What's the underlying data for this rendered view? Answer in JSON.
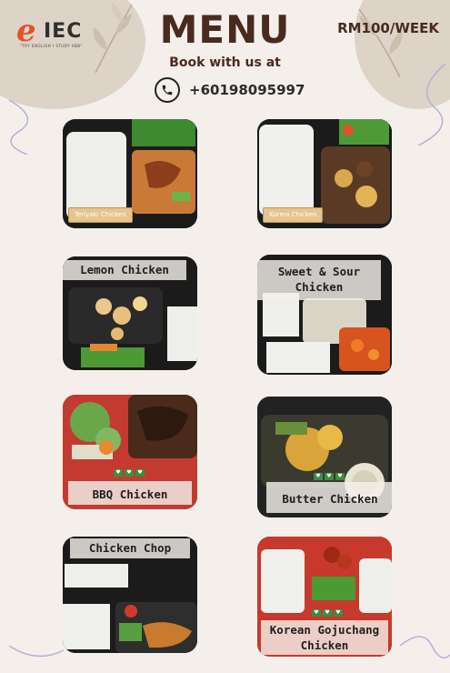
{
  "header": {
    "logo_letter": "e",
    "logo_text": "IEC",
    "logo_tagline": "\"TRY ENGLISH I STUDY ABB\"",
    "title": "MENU",
    "price": "RM100/WEEK",
    "book_text": "Book with us at",
    "phone": "+60198095997",
    "phone_icon": "phone-icon"
  },
  "colors": {
    "accent": "#4a2a1f",
    "background": "#f4efea",
    "logo_orange": "#e0542b",
    "label_gold": "#e6c48c",
    "heart_green": "#3e8d3e"
  },
  "menu": [
    {
      "name": "Teriyaki Chicken"
    },
    {
      "name": "Kurma Chicken"
    },
    {
      "name": "Lemon Chicken"
    },
    {
      "name": "Sweet & Sour Chicken",
      "line1": "Sweet & Sour",
      "line2": "Chicken"
    },
    {
      "name": "BBQ Chicken"
    },
    {
      "name": "Butter Chicken"
    },
    {
      "name": "Chicken Chop"
    },
    {
      "name": "Korean Gojuchang Chicken",
      "line1": "Korean Gojuchang",
      "line2": "Chicken"
    }
  ]
}
